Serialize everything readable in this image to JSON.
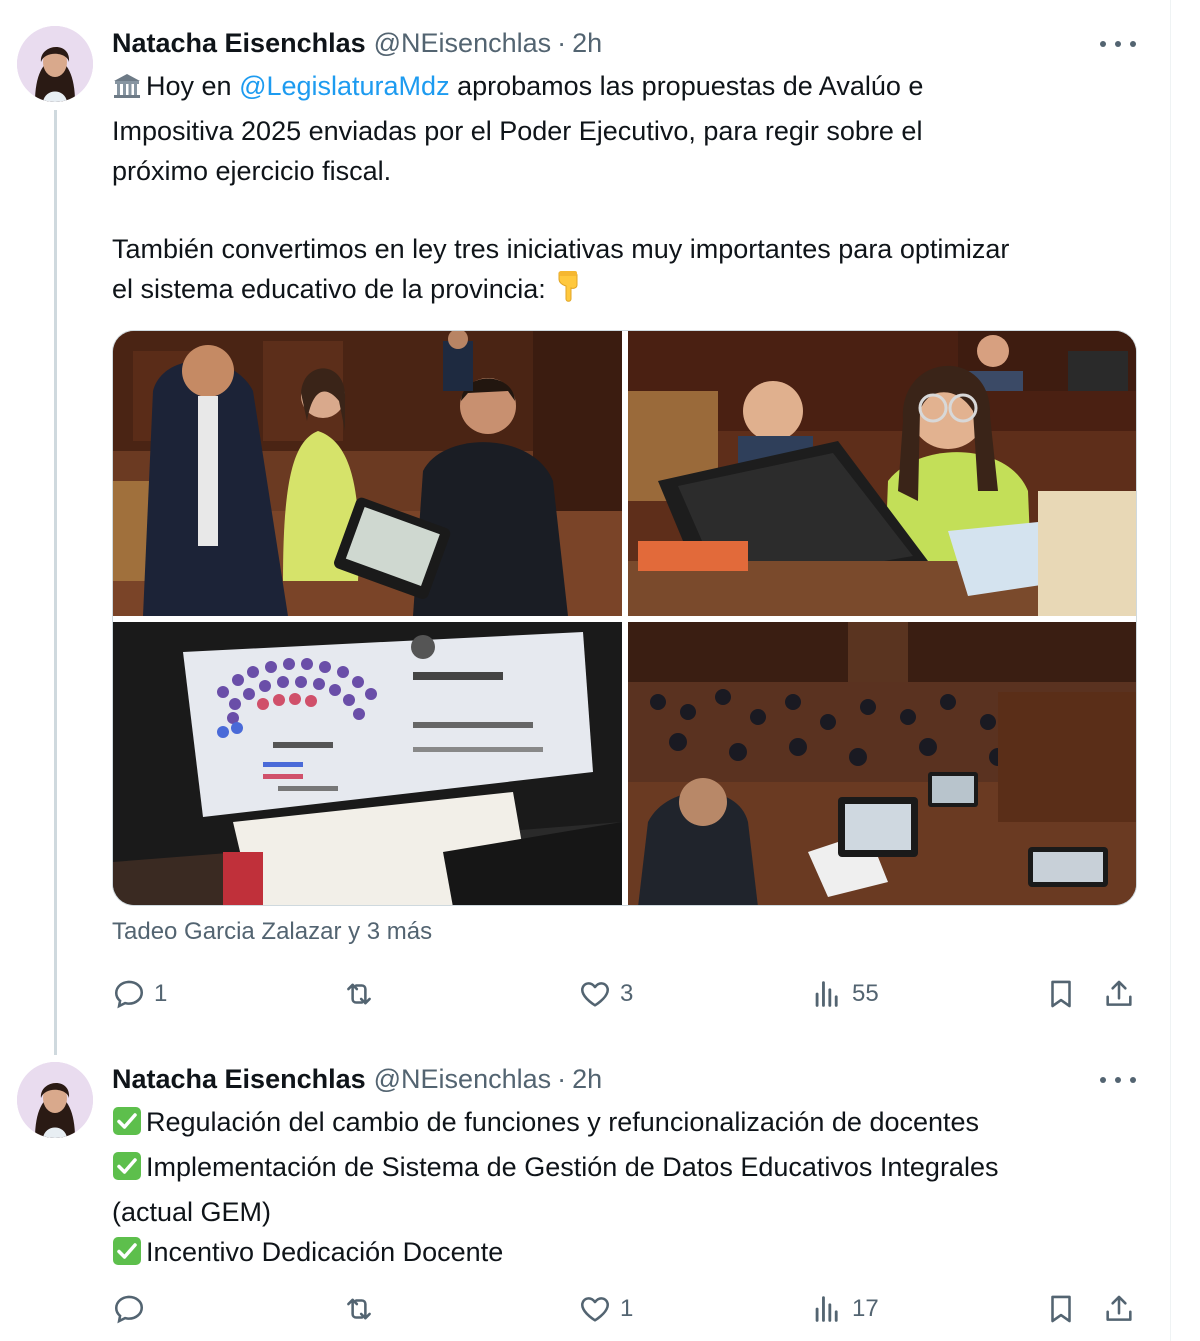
{
  "tweets": [
    {
      "author": {
        "name": "Natacha Eisenchlas",
        "handle": "@NEisenchlas",
        "separator": "·",
        "time": "2h"
      },
      "text": {
        "line1_emoji": "🏛️",
        "line1_pre": "Hoy en ",
        "line1_mention": "@LegislaturaMdz",
        "line1_post": " aprobamos las propuestas de Avalúo e",
        "line2": "Impositiva 2025 enviadas por el Poder Ejecutivo, para regir sobre el",
        "line3": "próximo ejercicio fiscal.",
        "line4": "También convertimos en ley tres iniciativas muy importantes para optimizar",
        "line5_text": "el sistema educativo de la provincia: ",
        "line5_emoji": "👇"
      },
      "media_count": 4,
      "tagged": "Tadeo Garcia Zalazar y 3 más",
      "stats": {
        "replies": "1",
        "retweets": "",
        "likes": "3",
        "views": "55"
      }
    },
    {
      "author": {
        "name": "Natacha Eisenchlas",
        "handle": "@NEisenchlas",
        "separator": "·",
        "time": "2h"
      },
      "text": {
        "check": "✅",
        "item1": "Regulación del cambio de funciones y refuncionalización de docentes",
        "item2a": "Implementación de Sistema de Gestión de Datos Educativos Integrales",
        "item2b": "(actual GEM)",
        "item3": "Incentivo Dedicación Docente"
      },
      "stats": {
        "replies": "",
        "retweets": "",
        "likes": "1",
        "views": "17"
      }
    }
  ],
  "colors": {
    "accent": "#1d9bf0",
    "muted": "#536471",
    "text": "#0f1419",
    "border": "#cfd9de",
    "check": "#5dbf4c"
  },
  "icons": [
    "reply-icon",
    "retweet-icon",
    "like-icon",
    "views-icon",
    "bookmark-icon",
    "share-icon",
    "more-icon",
    "building-emoji-icon",
    "pointing-down-emoji-icon",
    "check-emoji-icon"
  ]
}
